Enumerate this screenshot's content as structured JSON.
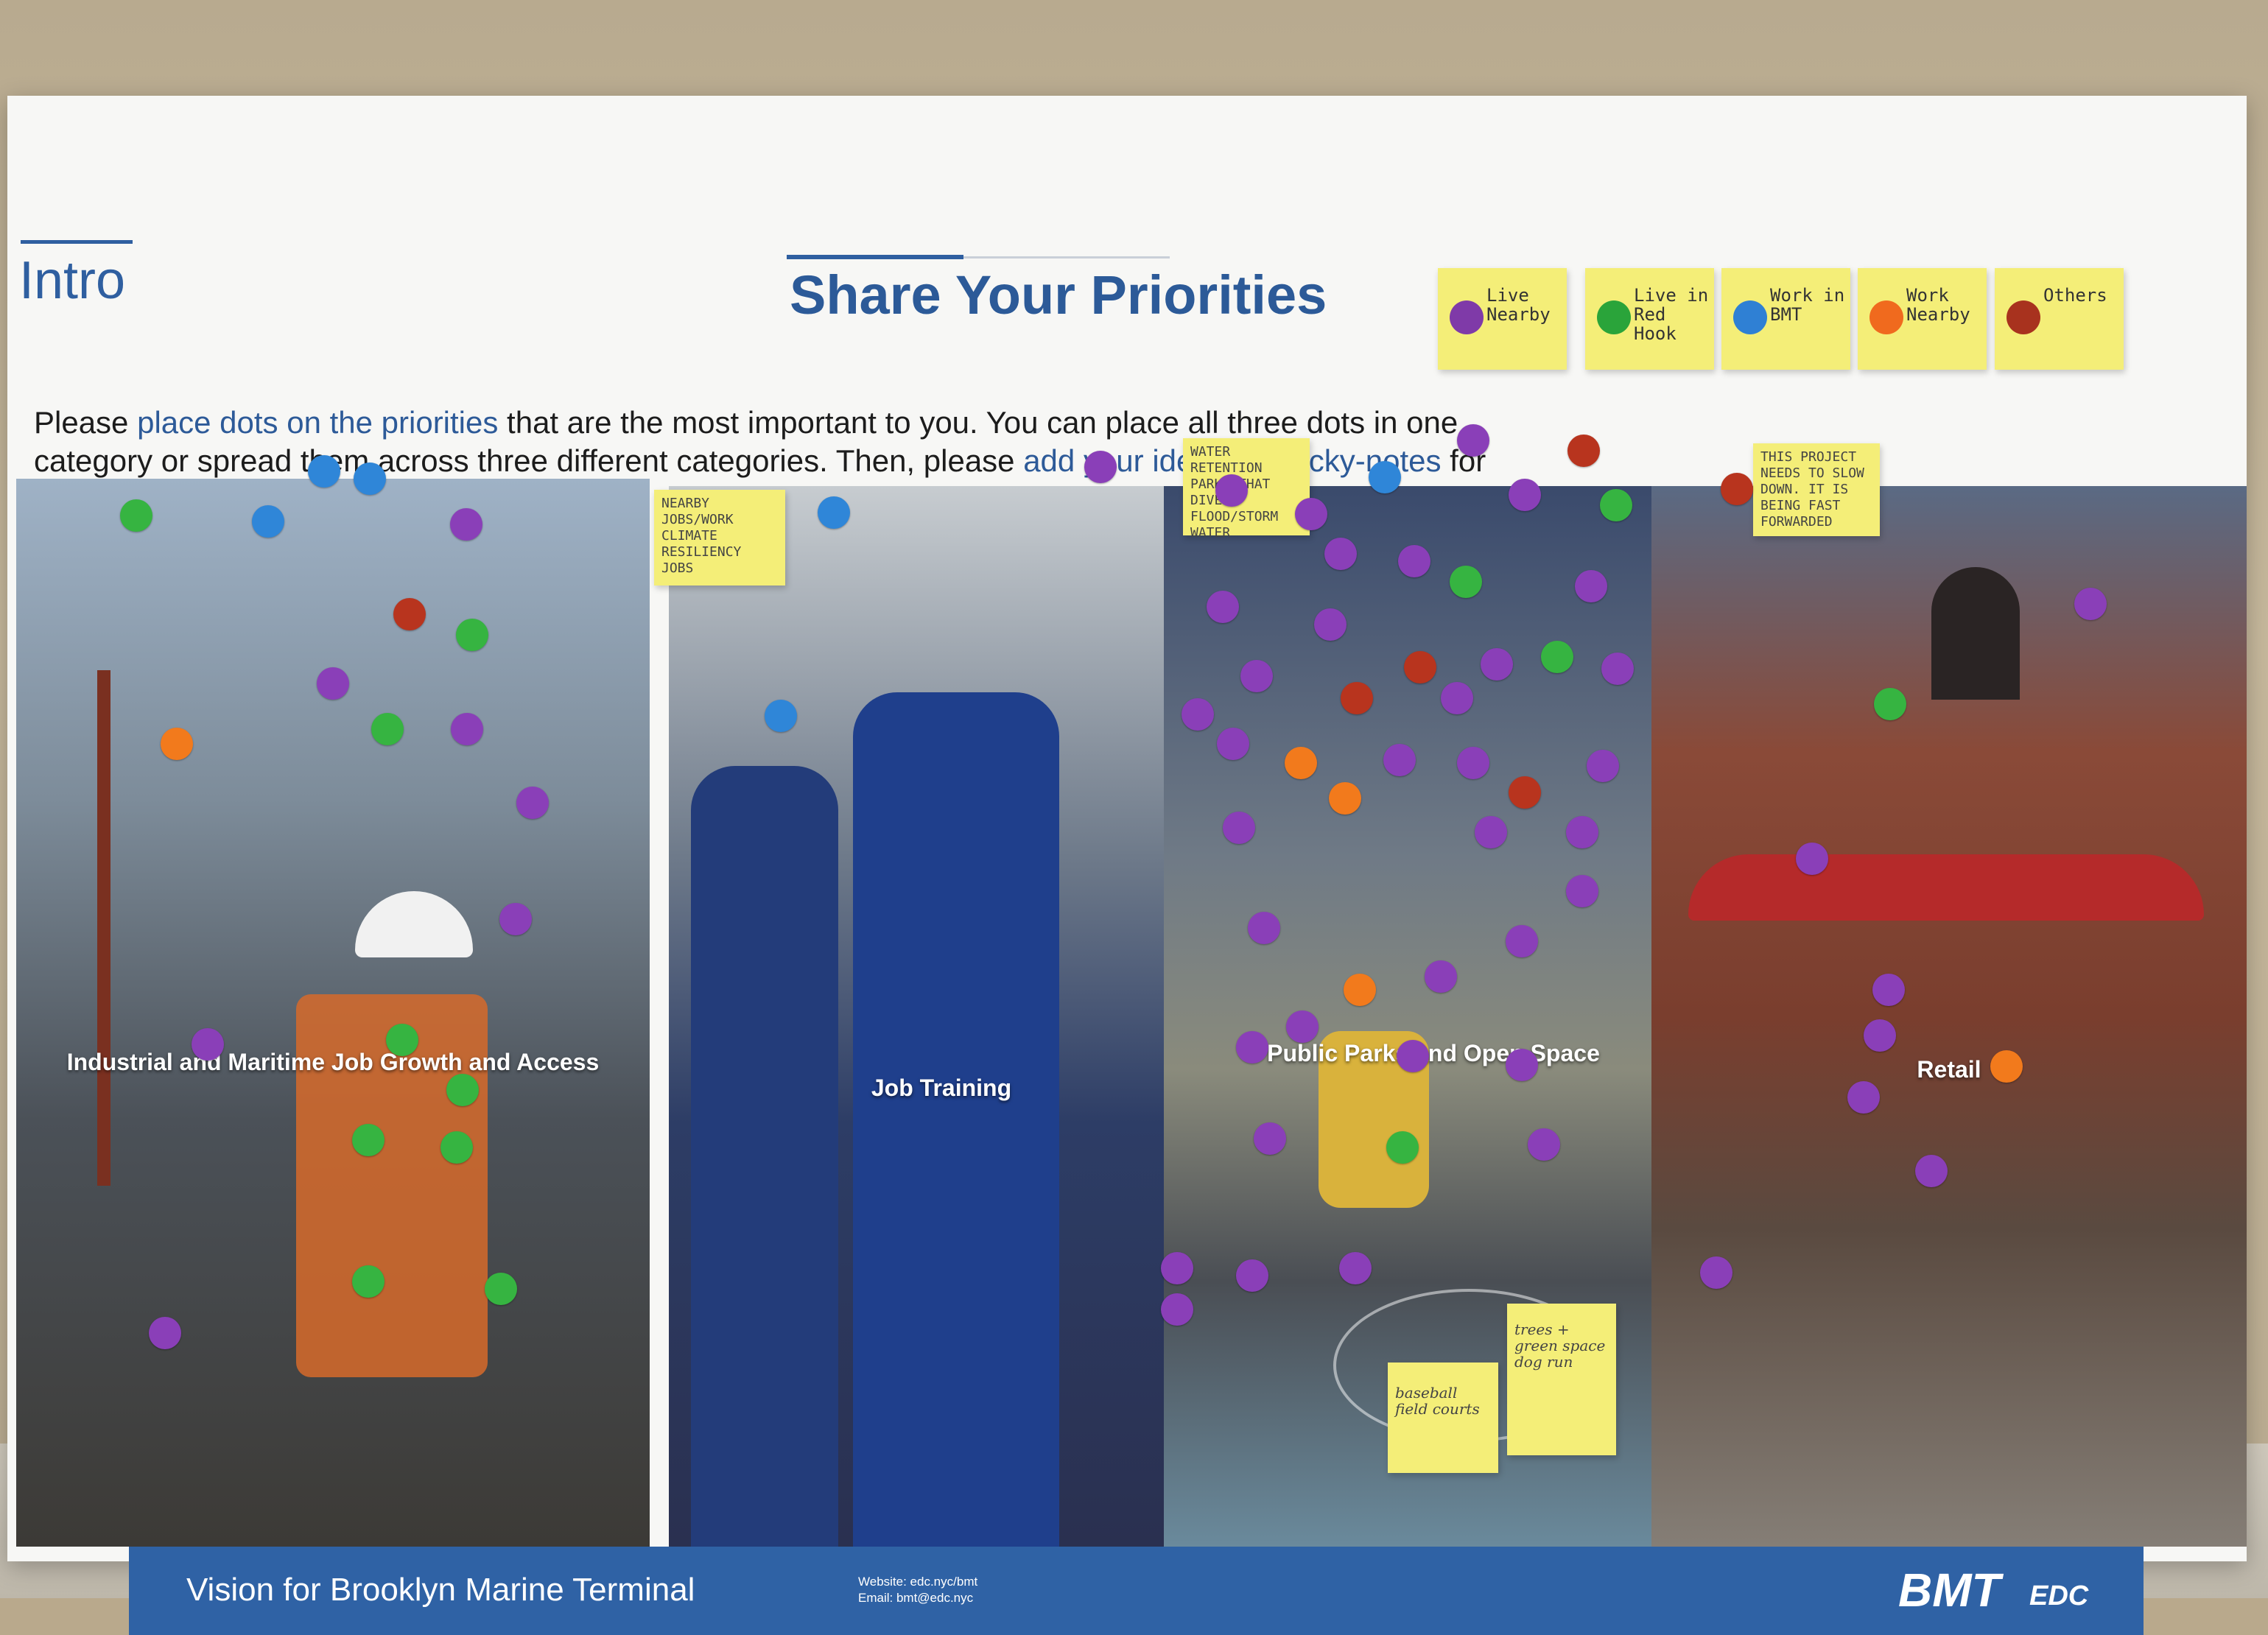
{
  "header": {
    "section_label": "Intro",
    "title": "Share Your Priorities"
  },
  "legend": [
    {
      "label": "Live Nearby",
      "color": "#7f3aa8"
    },
    {
      "label": "Live in Red Hook",
      "color": "#2aa43a"
    },
    {
      "label": "Work in BMT",
      "color": "#2f80d4"
    },
    {
      "label": "Work Nearby",
      "color": "#f06a1e"
    },
    {
      "label": "Others",
      "color": "#a8321e"
    }
  ],
  "instructions": {
    "part1": "Please ",
    "highlight1": "place dots on the priorities",
    "part2": " that are the most important to you. You can place all three dots in one category or spread them across three different categories. Then, please ",
    "highlight2": "add your ideas on sticky-notes",
    "part3": " for any of the categories listed below."
  },
  "panels": [
    {
      "label": "Industrial and Maritime Job Growth and Access"
    },
    {
      "label": "Job Training"
    },
    {
      "label": "Public Parks and Open Space"
    },
    {
      "label": "Retail"
    }
  ],
  "sticky_notes": {
    "job_training": "NEARBY JOBS/WORK CLIMATE RESILIENCY JOBS",
    "parks_top": "WATER RETENTION PARKS THAT DIVERT FLOOD/STORM WATER",
    "retail_top": "THIS PROJECT NEEDS TO SLOW DOWN. IT IS BEING FAST FORWARDED",
    "parks_bottom_left": "baseball field courts",
    "parks_bottom_right": "trees + green space dog run"
  },
  "footer": {
    "title": "Vision for Brooklyn Marine Terminal",
    "website": "Website: edc.nyc/bmt",
    "email": "Email: bmt@edc.nyc",
    "logo": "BMT",
    "logo_sub": "EDC"
  }
}
